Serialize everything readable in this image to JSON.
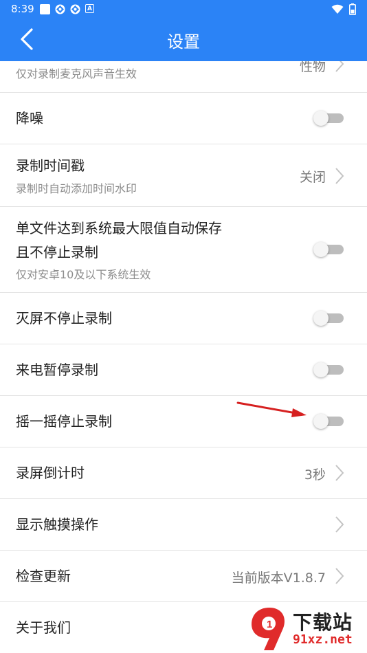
{
  "status_bar": {
    "time": "8:39",
    "notification_icons": [
      "square-icon",
      "diamond-icon",
      "diamond-icon",
      "a-icon"
    ],
    "system_icons": [
      "wifi-icon",
      "battery-icon"
    ]
  },
  "header": {
    "title": "设置",
    "background_color": "#2b83f6"
  },
  "settings": [
    {
      "id": "partial",
      "title": "",
      "subtitle": "仅对录制麦克风声音生效",
      "value": "性物",
      "control": "chevron"
    },
    {
      "id": "noise",
      "title": "降噪",
      "subtitle": "",
      "value": "",
      "control": "toggle",
      "on": false
    },
    {
      "id": "timestamp",
      "title": "录制时间戳",
      "subtitle": "录制时自动添加时间水印",
      "value": "关闭",
      "control": "chevron"
    },
    {
      "id": "autosave",
      "title": "单文件达到系统最大限值自动保存",
      "title2": "且不停止录制",
      "subtitle": "仅对安卓10及以下系统生效",
      "value": "",
      "control": "toggle",
      "on": false
    },
    {
      "id": "screen-off",
      "title": "灭屏不停止录制",
      "subtitle": "",
      "value": "",
      "control": "toggle",
      "on": false
    },
    {
      "id": "call-pause",
      "title": "来电暂停录制",
      "subtitle": "",
      "value": "",
      "control": "toggle",
      "on": false
    },
    {
      "id": "shake-stop",
      "title": "摇一摇停止录制",
      "subtitle": "",
      "value": "",
      "control": "toggle",
      "on": false
    },
    {
      "id": "countdown",
      "title": "录屏倒计时",
      "subtitle": "",
      "value": "3秒",
      "control": "chevron"
    },
    {
      "id": "touch",
      "title": "显示触摸操作",
      "subtitle": "",
      "value": "",
      "control": "chevron"
    },
    {
      "id": "update",
      "title": "检查更新",
      "subtitle": "",
      "value": "当前版本V1.8.7",
      "control": "chevron"
    },
    {
      "id": "about",
      "title": "关于我们",
      "subtitle": "",
      "value": "",
      "control": "none"
    }
  ],
  "watermark": {
    "logo_text": "下载站",
    "url": "91xz.net",
    "brand_color": "#e02b2b"
  },
  "annotation_color": "#d62020"
}
